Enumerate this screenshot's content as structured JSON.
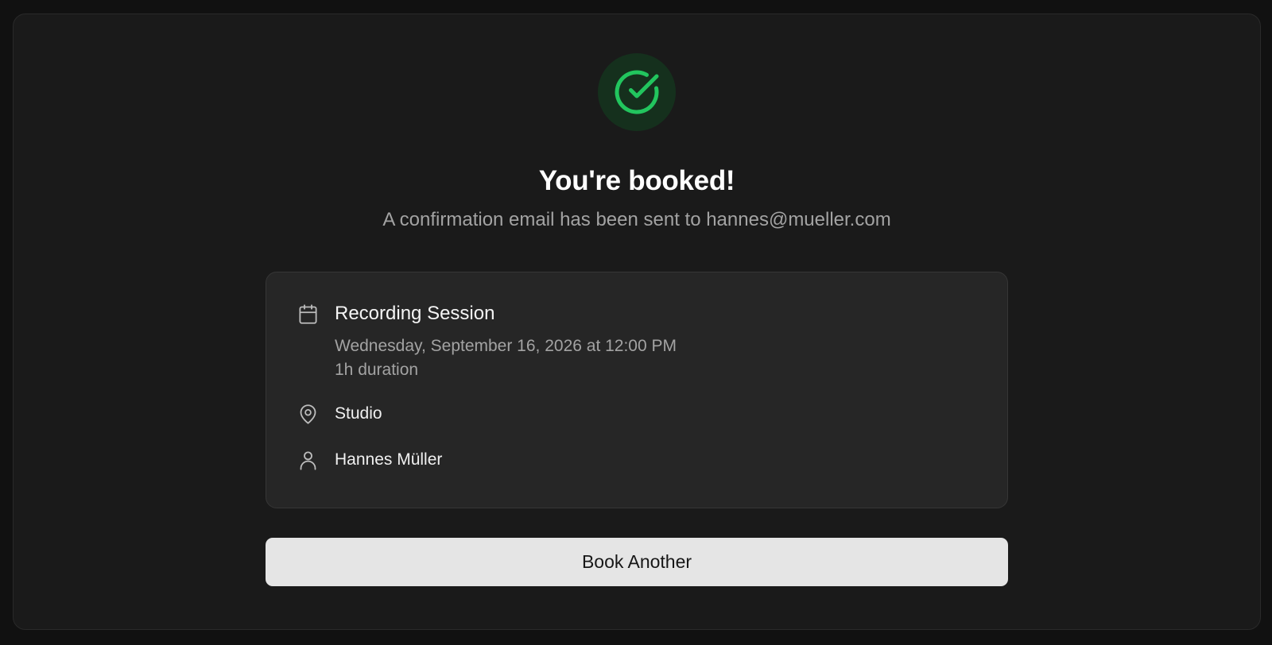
{
  "colors": {
    "success": "#22c55e",
    "background": "#1a1a1a",
    "card": "#262626",
    "button": "#e5e5e5"
  },
  "header": {
    "icon": "check-circle-icon",
    "title": "You're booked!",
    "subtitle": "A confirmation email has been sent to hannes@mueller.com"
  },
  "booking": {
    "event_icon": "calendar-icon",
    "event_name": "Recording Session",
    "datetime": "Wednesday, September 16, 2026 at 12:00 PM",
    "duration": "1h duration",
    "location_icon": "map-pin-icon",
    "location": "Studio",
    "host_icon": "user-icon",
    "host": "Hannes Müller"
  },
  "actions": {
    "book_another_label": "Book Another"
  }
}
